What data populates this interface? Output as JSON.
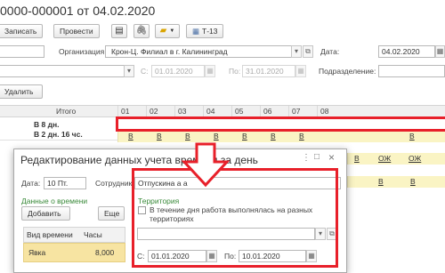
{
  "doc": {
    "title": "0000-000001 от 04.02.2020"
  },
  "toolbar": {
    "write_label": "Записать",
    "post_label": "Провести",
    "t13_label": "Т-13"
  },
  "filters": {
    "org_label": "Организация:",
    "org_value": "Крон-Ц. Филиал в г. Калининград",
    "date_label": "Дата:",
    "date_value": "04.02.2020",
    "from_label": "С:",
    "from_value": "01.01.2020",
    "to_label": "По:",
    "to_value": "31.01.2020",
    "subdivision_label": "Подразделение:",
    "delete_label": "Удалить"
  },
  "grid": {
    "total_header": "Итого",
    "days": [
      "01",
      "02",
      "03",
      "04",
      "05",
      "06",
      "07",
      "08"
    ],
    "total_line1": "В 8 дн.",
    "total_line2": "В 2 дн. 16 чс.",
    "row2_marks": [
      "В",
      "В",
      "В",
      "В",
      "В",
      "В",
      "В",
      "В"
    ],
    "row3_marks": [
      "В",
      "ОЖ",
      "ОЖ"
    ],
    "row4_marks": [
      "В",
      "В"
    ]
  },
  "dialog": {
    "title": "Редактирование данных учета времени за день",
    "date_label": "Дата:",
    "date_value": "10 Пт.",
    "employee_label": "Сотрудник:",
    "employee_value": "Отпускина а а",
    "time_data_label": "Данные о времени",
    "add_label": "Добавить",
    "more_label": "Еще",
    "col_kind": "Вид времени",
    "col_hours": "Часы",
    "row_kind": "Явка",
    "row_hours": "8,000",
    "territory_label": "Территория",
    "checkbox_text_1": "В течение дня работа выполнялась на разных",
    "checkbox_text_2": "территориях",
    "from_label": "С:",
    "from_value": "01.01.2020",
    "to_label": "По:",
    "to_value": "10.01.2020"
  },
  "colors": {
    "annotation_red": "#e8202a",
    "holiday_yellow": "#faf4c4",
    "selected_row": "#f7e4a2",
    "green_label": "#3a8a3a"
  }
}
